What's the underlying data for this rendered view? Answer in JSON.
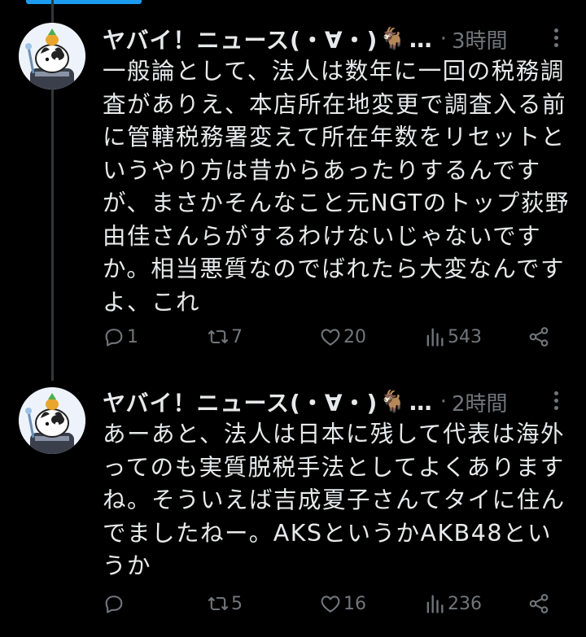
{
  "tweets": [
    {
      "name": "ヤバイ！ニュース(・∀・)",
      "emoji": "🐐",
      "ellipsis": "…",
      "sep": "·",
      "time": "3時間",
      "lines": [
        "一般論として、法人は数年に一回の税務調",
        "査がありえ、本店所在地変更で調査入る前",
        "に管轄税務署変えて所在年数をリセットと",
        "いうやり方は昔からあったりするんです",
        "が、まさかそんなこと元NGTのトップ荻野",
        "由佳さんらがするわけないじゃないです",
        "か。相当悪質なのでばれたら大変なんです",
        "よ、これ"
      ],
      "replies": "1",
      "retweets": "7",
      "likes": "20",
      "views": "543"
    },
    {
      "name": "ヤバイ！ニュース(・∀・)",
      "emoji": "🐐",
      "ellipsis": "…",
      "sep": "·",
      "time": "2時間",
      "lines": [
        "あーあと、法人は日本に残して代表は海外",
        "ってのも実質脱税手法としてよくあります",
        "ね。そういえば吉成夏子さんてタイに住ん",
        "でましたねー。AKSというかAKB48とい",
        "うか"
      ],
      "replies": "",
      "retweets": "5",
      "likes": "16",
      "views": "236"
    }
  ],
  "colors": {
    "background": "#000000",
    "text": "#e7e9ea",
    "muted": "#71767b",
    "accent": "#1d9bf0",
    "thread_line": "#333639"
  },
  "icons": [
    "reply-icon",
    "retweet-icon",
    "like-icon",
    "views-icon",
    "share-icon",
    "more-icon"
  ]
}
